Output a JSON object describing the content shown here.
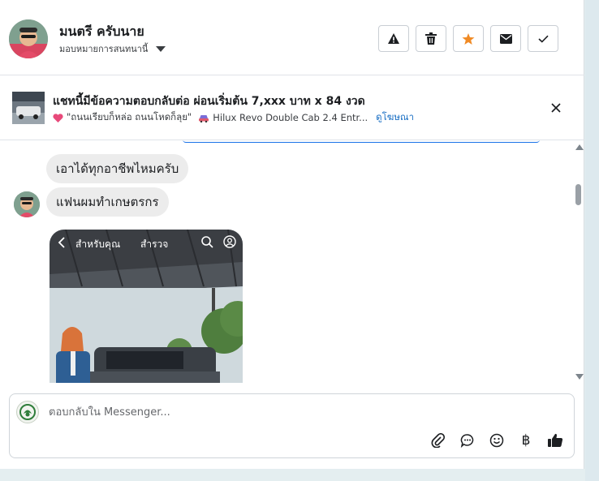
{
  "header": {
    "contact_name": "มนตรี ครับนาย",
    "assign_label": "มอบหมายการสนทนานี้"
  },
  "ad": {
    "title": "แชทนี้มีข้อความตอบกลับต่อ ผ่อนเริ่มต้น 7,xxx บาท x 84 งวด",
    "subtitle": "\"ถนนเรียบก็หล่อ ถนนโหดก็ลุย\"",
    "product": "Hilux Revo Double Cab 2.4 Entr...",
    "link": "ดูโฆษณา"
  },
  "messages": [
    {
      "text": "เอาได้ทุกอาชีพไหมครับ"
    },
    {
      "text": "แฟนผมทำเกษตรกร"
    }
  ],
  "photo": {
    "tab_for_you": "สำหรับคุณ",
    "tab_explore": "สำรวจ"
  },
  "composer": {
    "placeholder": "ตอบกลับใน Messenger...",
    "currency_symbol": "฿"
  },
  "colors": {
    "link": "#1a6fc4",
    "star": "#f08a24",
    "scroll_blue": "#1a73e8"
  }
}
